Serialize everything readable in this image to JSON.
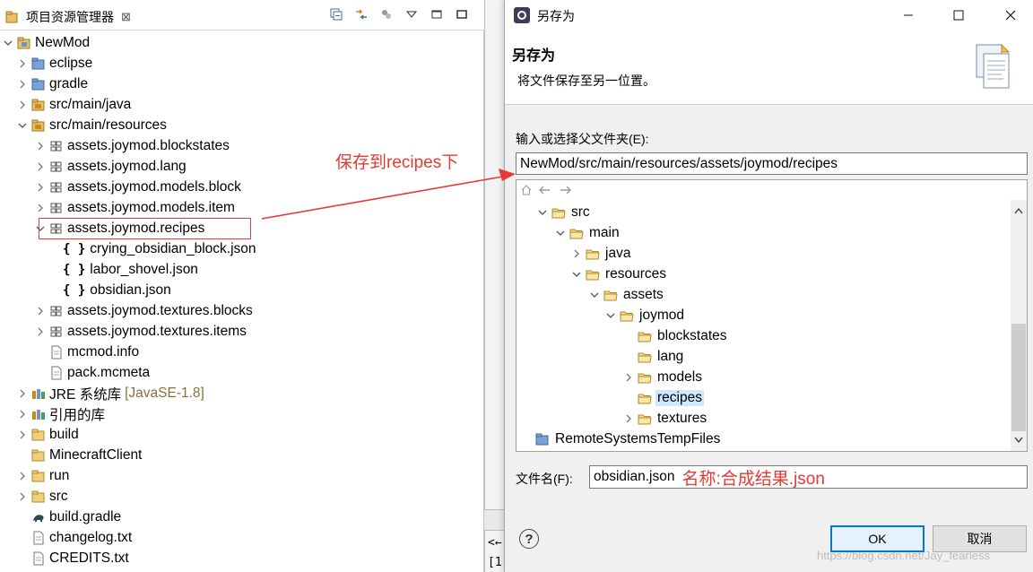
{
  "explorer": {
    "tab_label": "项目资源管理器",
    "close_glyph": "⊠",
    "tree": [
      {
        "label": "NewMod",
        "icon": "project-icon",
        "expand": "open"
      },
      {
        "label": "eclipse",
        "icon": "folder-link-icon",
        "expand": "closed"
      },
      {
        "label": "gradle",
        "icon": "folder-link-icon",
        "expand": "closed"
      },
      {
        "label": "src/main/java",
        "icon": "source-folder-icon",
        "expand": "closed"
      },
      {
        "label": "src/main/resources",
        "icon": "source-folder-icon",
        "expand": "open"
      },
      {
        "label": "assets.joymod.blockstates",
        "icon": "package-icon",
        "expand": "closed"
      },
      {
        "label": "assets.joymod.lang",
        "icon": "package-icon",
        "expand": "closed"
      },
      {
        "label": "assets.joymod.models.block",
        "icon": "package-icon",
        "expand": "closed"
      },
      {
        "label": "assets.joymod.models.item",
        "icon": "package-icon",
        "expand": "closed"
      },
      {
        "label": "assets.joymod.recipes",
        "icon": "package-icon",
        "expand": "open"
      },
      {
        "label": "crying_obsidian_block.json",
        "icon": "json-file-icon",
        "expand": "none"
      },
      {
        "label": "labor_shovel.json",
        "icon": "json-file-icon",
        "expand": "none"
      },
      {
        "label": "obsidian.json",
        "icon": "json-file-icon",
        "expand": "none"
      },
      {
        "label": "assets.joymod.textures.blocks",
        "icon": "package-icon",
        "expand": "closed"
      },
      {
        "label": "assets.joymod.textures.items",
        "icon": "package-icon",
        "expand": "closed"
      },
      {
        "label": "mcmod.info",
        "icon": "file-icon",
        "expand": "none"
      },
      {
        "label": "pack.mcmeta",
        "icon": "file-icon",
        "expand": "none"
      },
      {
        "label": "JRE 系统库",
        "decor": "[JavaSE-1.8]",
        "icon": "library-icon",
        "expand": "closed"
      },
      {
        "label": "引用的库",
        "icon": "library-icon",
        "expand": "closed"
      },
      {
        "label": "build",
        "icon": "folder-icon",
        "expand": "closed"
      },
      {
        "label": "MinecraftClient",
        "icon": "folder-icon",
        "expand": "none"
      },
      {
        "label": "run",
        "icon": "folder-icon",
        "expand": "closed"
      },
      {
        "label": "src",
        "icon": "folder-icon",
        "expand": "closed"
      },
      {
        "label": "build.gradle",
        "icon": "gradle-file-icon",
        "expand": "none"
      },
      {
        "label": "changelog.txt",
        "icon": "file-icon",
        "expand": "none"
      },
      {
        "label": "CREDITS.txt",
        "icon": "file-icon",
        "expand": "none"
      }
    ]
  },
  "annotation": {
    "arrow_text": "保存到recipes下",
    "color": "#e53935"
  },
  "dialog": {
    "window_title": "另存为",
    "header_title": "另存为",
    "header_desc": "将文件保存至另一位置。",
    "parent_label": "输入或选择父文件夹(E):",
    "parent_value": "NewMod/src/main/resources/assets/joymod/recipes",
    "folder_tree": [
      {
        "label": "src",
        "expand": "open"
      },
      {
        "label": "main",
        "expand": "open"
      },
      {
        "label": "java",
        "expand": "closed"
      },
      {
        "label": "resources",
        "expand": "open"
      },
      {
        "label": "assets",
        "expand": "open"
      },
      {
        "label": "joymod",
        "expand": "open"
      },
      {
        "label": "blockstates",
        "expand": "none"
      },
      {
        "label": "lang",
        "expand": "none"
      },
      {
        "label": "models",
        "expand": "closed"
      },
      {
        "label": "recipes",
        "expand": "none",
        "selected": true
      },
      {
        "label": "textures",
        "expand": "closed"
      },
      {
        "label": "RemoteSystemsTempFiles",
        "expand": "none",
        "project": true
      }
    ],
    "filename_label": "文件名(F):",
    "filename_value": "obsidian.json",
    "filename_note": "名称:合成结果.json",
    "ok_label": "OK",
    "cancel_label": "取消",
    "help_glyph": "?",
    "watermark": "https://blog.csdn.net/Jay_fearless"
  },
  "console": {
    "line1": "<←",
    "line2": "[1"
  }
}
